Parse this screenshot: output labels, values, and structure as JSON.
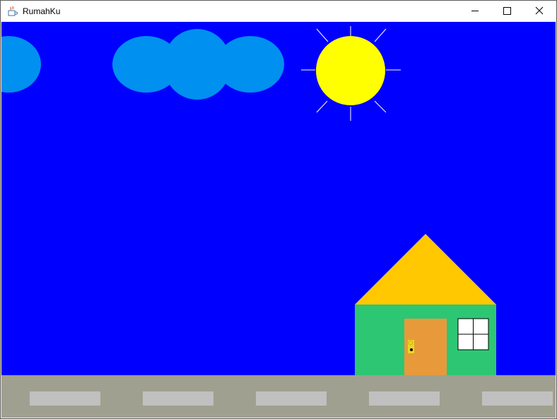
{
  "window": {
    "title": "RumahKu",
    "app_icon": "java-coffee-icon",
    "controls": [
      "minimize-icon",
      "maximize-icon",
      "close-icon"
    ]
  },
  "scene": {
    "sky_color": "#0000ff",
    "cloud_color": "#0090f0",
    "sun_color": "#ffff00",
    "sun_ray_color": "#ffffff",
    "roof_color": "#ffc800",
    "wall_color": "#2dc673",
    "door_color": "#e89a3a",
    "door_knob_color": "#e8d820",
    "window_color": "#ffffff",
    "road_color": "#a0a090",
    "road_marking_color": "#c0c0c0"
  }
}
